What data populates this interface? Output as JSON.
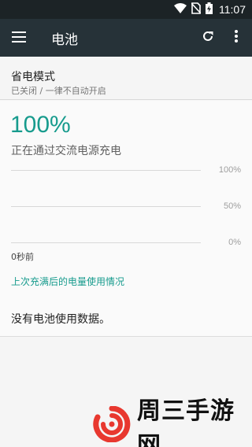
{
  "status_bar": {
    "time": "11:07"
  },
  "app_bar": {
    "title": "电池"
  },
  "battery_saver": {
    "title": "省电模式",
    "subtitle": "已关闭 / 一律不自动开启"
  },
  "battery": {
    "level_text": "100%",
    "status": "正在通过交流电源充电",
    "graph": {
      "y_labels": [
        "100%",
        "50%",
        "0%"
      ],
      "time_label": "0秒前"
    },
    "history_link": "上次充满后的电量使用情况",
    "no_data_text": "没有电池使用数据。"
  },
  "watermark": {
    "text": "周三手游网"
  },
  "colors": {
    "status_bar": "#1c2326",
    "app_bar": "#263238",
    "accent": "#179b8d"
  },
  "icons": [
    "wifi-icon",
    "no-sim-icon",
    "battery-charging-icon",
    "menu-icon",
    "refresh-icon",
    "more-vert-icon"
  ]
}
